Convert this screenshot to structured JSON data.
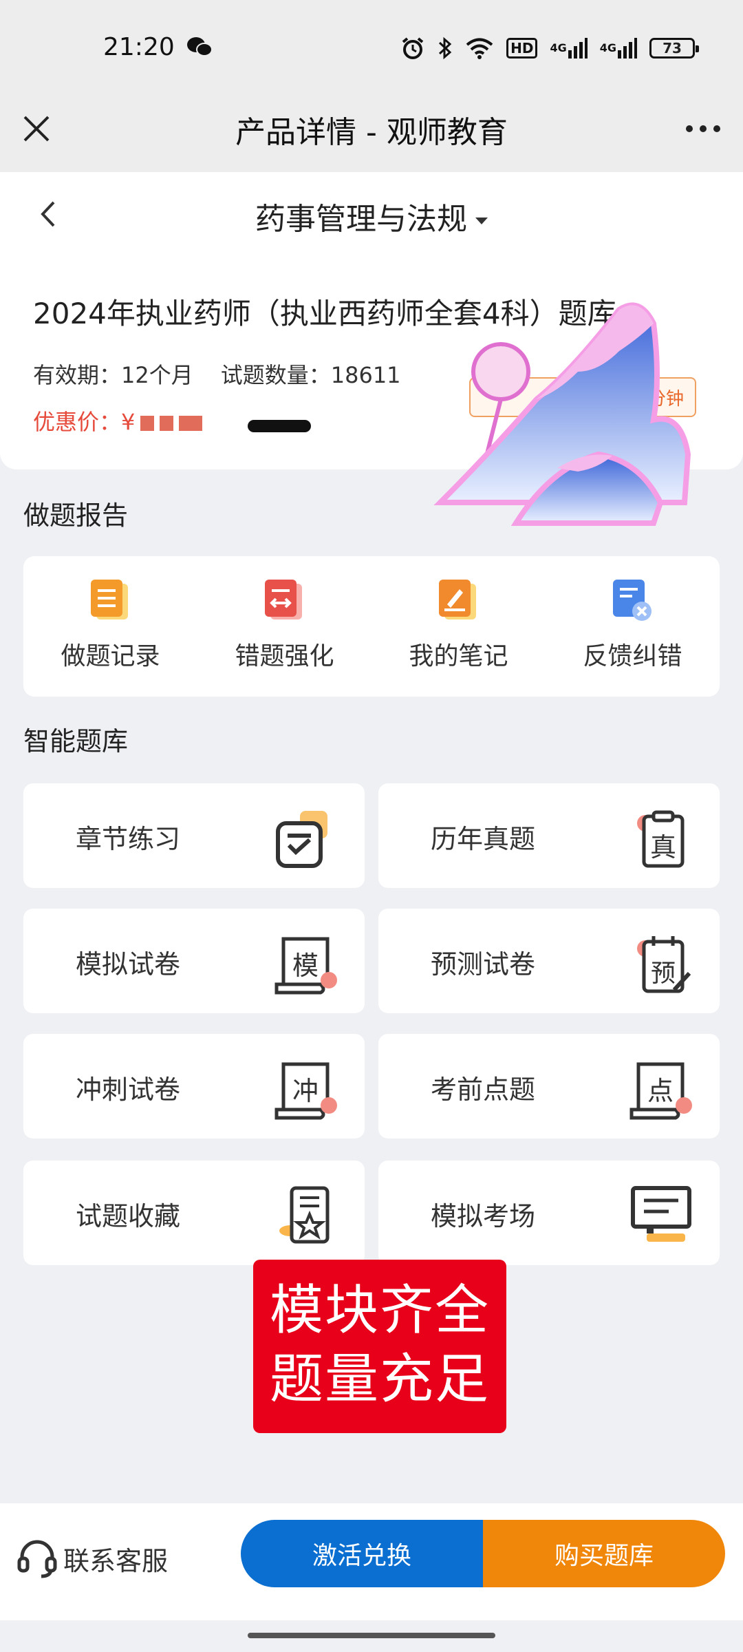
{
  "status_bar": {
    "time": "21:20",
    "hd_label": "HD",
    "signal_label": "4G",
    "battery": "73"
  },
  "title_bar": {
    "title": "产品详情 - 观师教育"
  },
  "subject_bar": {
    "subject": "药事管理与法规"
  },
  "product": {
    "name": "2024年执业药师（执业西药师全套4科）题库",
    "validity": "有效期：12个月",
    "question_count": "试题数量：18611",
    "price_label": "优惠价：¥",
    "promo_tag_right": "分钟"
  },
  "report_section": {
    "title": "做题报告",
    "items": [
      {
        "label": "做题记录",
        "icon": "record-icon",
        "color": "#f39a2b"
      },
      {
        "label": "错题强化",
        "icon": "wrong-question-icon",
        "color": "#e8504a"
      },
      {
        "label": "我的笔记",
        "icon": "notes-icon",
        "color": "#f1892d"
      },
      {
        "label": "反馈纠错",
        "icon": "feedback-icon",
        "color": "#4a86e8"
      }
    ]
  },
  "bank_section": {
    "title": "智能题库",
    "tiles": [
      {
        "label": "章节练习",
        "icon": "chapter-practice-icon",
        "glyph": ""
      },
      {
        "label": "历年真题",
        "icon": "past-exams-icon",
        "glyph": "真"
      },
      {
        "label": "模拟试卷",
        "icon": "mock-paper-icon",
        "glyph": "模"
      },
      {
        "label": "预测试卷",
        "icon": "predict-paper-icon",
        "glyph": "预"
      },
      {
        "label": "冲刺试卷",
        "icon": "sprint-paper-icon",
        "glyph": "冲"
      },
      {
        "label": "考前点题",
        "icon": "key-points-icon",
        "glyph": "点"
      },
      {
        "label": "试题收藏",
        "icon": "favorites-icon",
        "glyph": ""
      },
      {
        "label": "模拟考场",
        "icon": "mock-exam-room-icon",
        "glyph": ""
      }
    ]
  },
  "banner": {
    "line1": "模块齐全",
    "line2": "题量充足",
    "color": "#e8001a"
  },
  "bottom_bar": {
    "service": "联系客服",
    "activate": "激活兑换",
    "buy": "购买题库",
    "activate_color": "#0a6fd0",
    "buy_color": "#f0870b"
  }
}
